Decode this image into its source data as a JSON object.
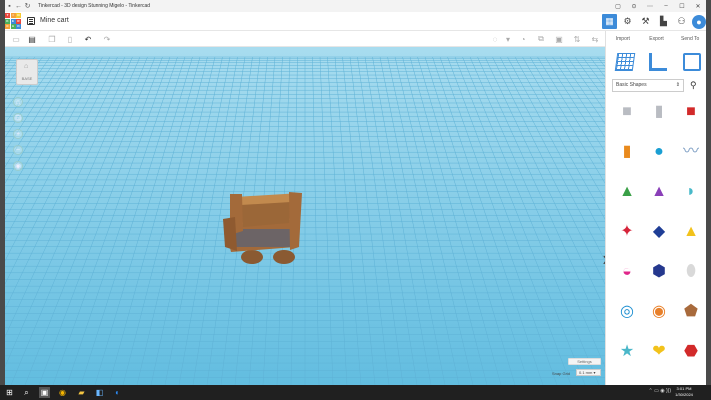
{
  "window": {
    "title": "Tinkercad - 3D design Stunning Migelo - Tinkercad",
    "min_glyph": "–",
    "max_glyph": "☐",
    "close_glyph": "✕"
  },
  "header": {
    "logo_letters": [
      "T",
      "I",
      "N",
      "K",
      "E",
      "R",
      "C",
      "A",
      "D"
    ],
    "logo_colors": [
      "#e8473d",
      "#f6a13a",
      "#f6cb31",
      "#4ab05c",
      "#3c8bd9",
      "#e8473d",
      "#f6a13a",
      "#4ab05c",
      "#3c8bd9"
    ],
    "design_name": "Mine cart",
    "grid_glyph": "▦"
  },
  "panel": {
    "tabs": [
      "Import",
      "Export",
      "Send To"
    ],
    "shape_category": "Basic Shapes",
    "search_glyph": "⚲",
    "shapes": [
      {
        "name": "box-hole",
        "color": "#b9bcc2"
      },
      {
        "name": "cylinder-hole",
        "color": "#b9bcc2"
      },
      {
        "name": "box",
        "color": "#d22a2a"
      },
      {
        "name": "cylinder",
        "color": "#e98a1d"
      },
      {
        "name": "sphere",
        "color": "#1a9fd3"
      },
      {
        "name": "scribble",
        "color": "#7e9fc4"
      },
      {
        "name": "roof",
        "color": "#3aa047"
      },
      {
        "name": "cone",
        "color": "#8a3fb8"
      },
      {
        "name": "round-roof",
        "color": "#48b9c9"
      },
      {
        "name": "text",
        "color": "#d6243a"
      },
      {
        "name": "wedge",
        "color": "#1f3e96"
      },
      {
        "name": "pyramid",
        "color": "#f2c21b"
      },
      {
        "name": "half-sphere",
        "color": "#e0268a"
      },
      {
        "name": "polygon",
        "color": "#25388e"
      },
      {
        "name": "paraboloid",
        "color": "#d9d9d9"
      },
      {
        "name": "torus",
        "color": "#1d8fd1"
      },
      {
        "name": "tube",
        "color": "#e8802a"
      },
      {
        "name": "icosahedron",
        "color": "#a86a3c"
      },
      {
        "name": "star",
        "color": "#4bb7c9"
      },
      {
        "name": "heart",
        "color": "#f2c21b"
      },
      {
        "name": "polyhedron",
        "color": "#d22a2a"
      }
    ]
  },
  "viewport": {
    "viewcube_label": "BASE",
    "settings_label": "Settings",
    "snap_label": "Snap Grid",
    "snap_value": "0.1 mm ▾"
  },
  "taskbar": {
    "time": "3:01 PM",
    "date": "1/30/2024"
  }
}
